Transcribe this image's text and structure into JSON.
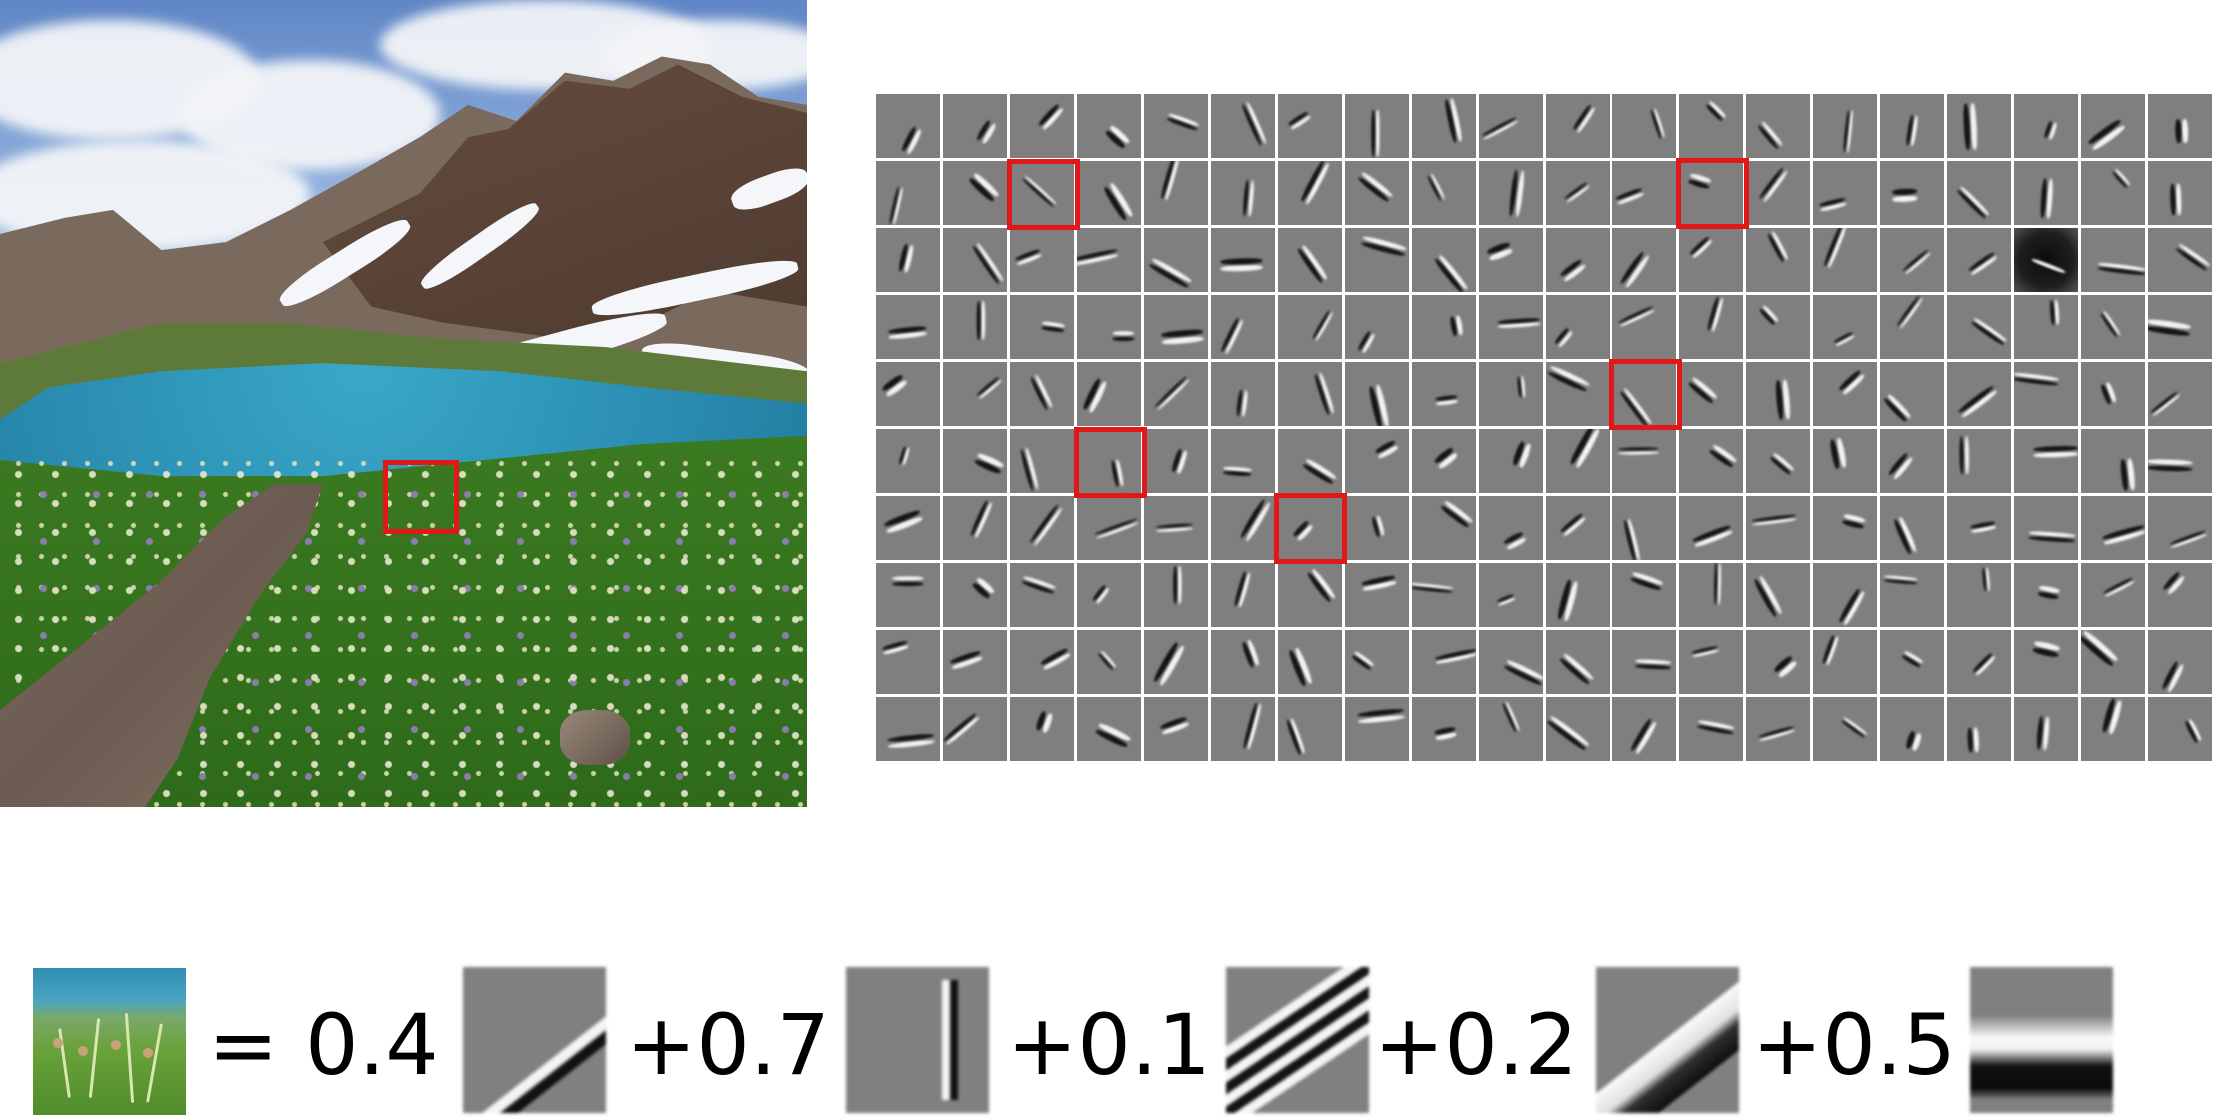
{
  "equation": {
    "equals": "= 0.4",
    "terms": [
      "+0.7",
      "+0.1",
      "+0.2",
      "+0.5"
    ],
    "coefficients": [
      0.4,
      0.7,
      0.1,
      0.2,
      0.5
    ]
  },
  "filter_grid": {
    "rows": 10,
    "cols": 20
  },
  "colors": {
    "highlight": "#e01818",
    "filter_gray": "#7f7f7f"
  }
}
